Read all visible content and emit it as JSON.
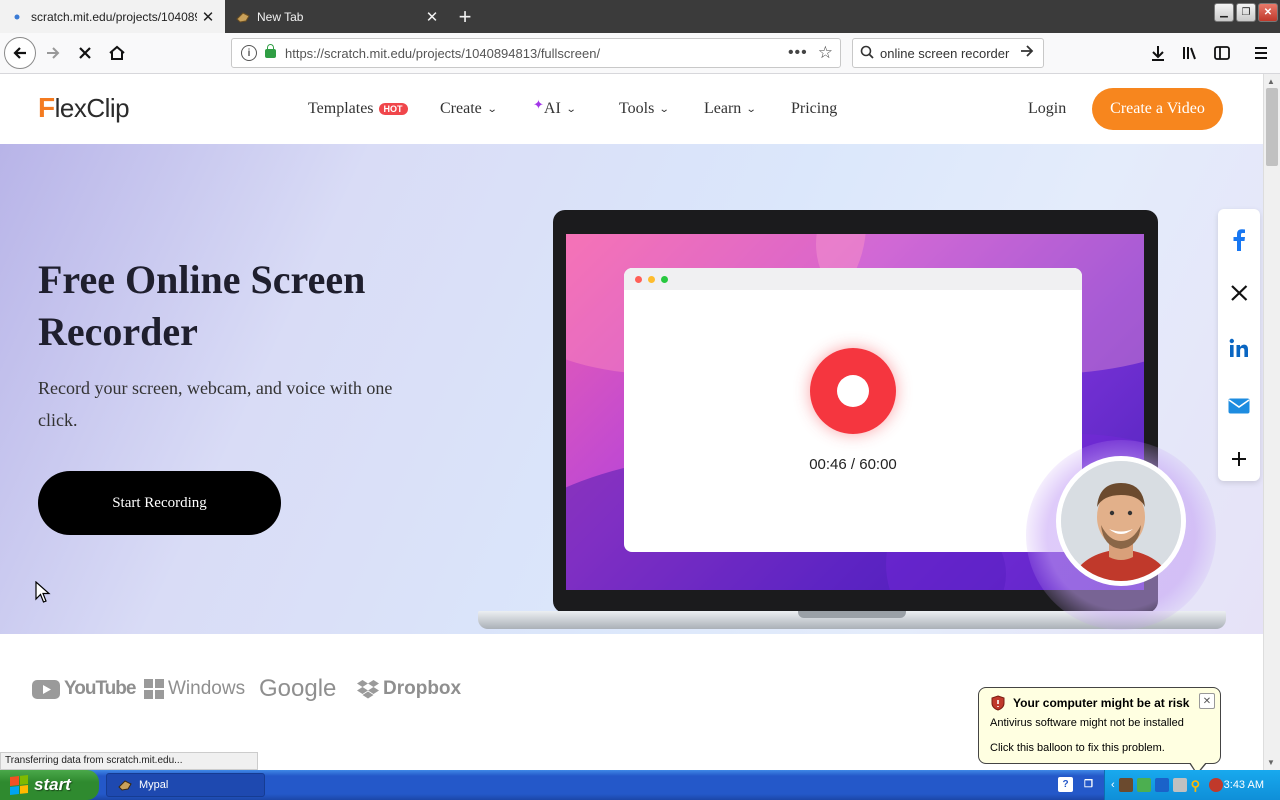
{
  "browser": {
    "tabs": [
      {
        "label": "scratch.mit.edu/projects/10408948",
        "active": true
      },
      {
        "label": "New Tab",
        "active": false
      }
    ],
    "url": "https://scratch.mit.edu/projects/1040894813/fullscreen/",
    "search_value": "online screen recorder",
    "status_text": "Transferring data from scratch.mit.edu..."
  },
  "site": {
    "logo_text": "FlexClip",
    "nav": [
      {
        "label": "Templates",
        "badge": "HOT"
      },
      {
        "label": "Create"
      },
      {
        "label": "AI"
      },
      {
        "label": "Tools"
      },
      {
        "label": "Learn"
      },
      {
        "label": "Pricing"
      }
    ],
    "login_label": "Login",
    "cta_label": "Create a Video"
  },
  "hero": {
    "title": "Free Online Screen Recorder",
    "subtitle": "Record your screen, webcam, and voice with one click.",
    "button_label": "Start Recording",
    "timer": "00:46 / 60:00"
  },
  "share_icons": [
    "facebook-icon",
    "x-icon",
    "linkedin-icon",
    "mail-icon",
    "plus-icon"
  ],
  "brands": [
    "YouTube",
    "Windows",
    "Google",
    "Dropbox"
  ],
  "balloon": {
    "title": "Your computer might be at risk",
    "line1": "Antivirus software might not be installed",
    "line2": "Click this balloon to fix this problem."
  },
  "taskbar": {
    "start_label": "start",
    "task_label": "Mypal",
    "clock": "3:43 AM"
  },
  "colors": {
    "accent_orange": "#f7861e",
    "record_red": "#f5363f",
    "hot_badge": "#f0464b"
  }
}
